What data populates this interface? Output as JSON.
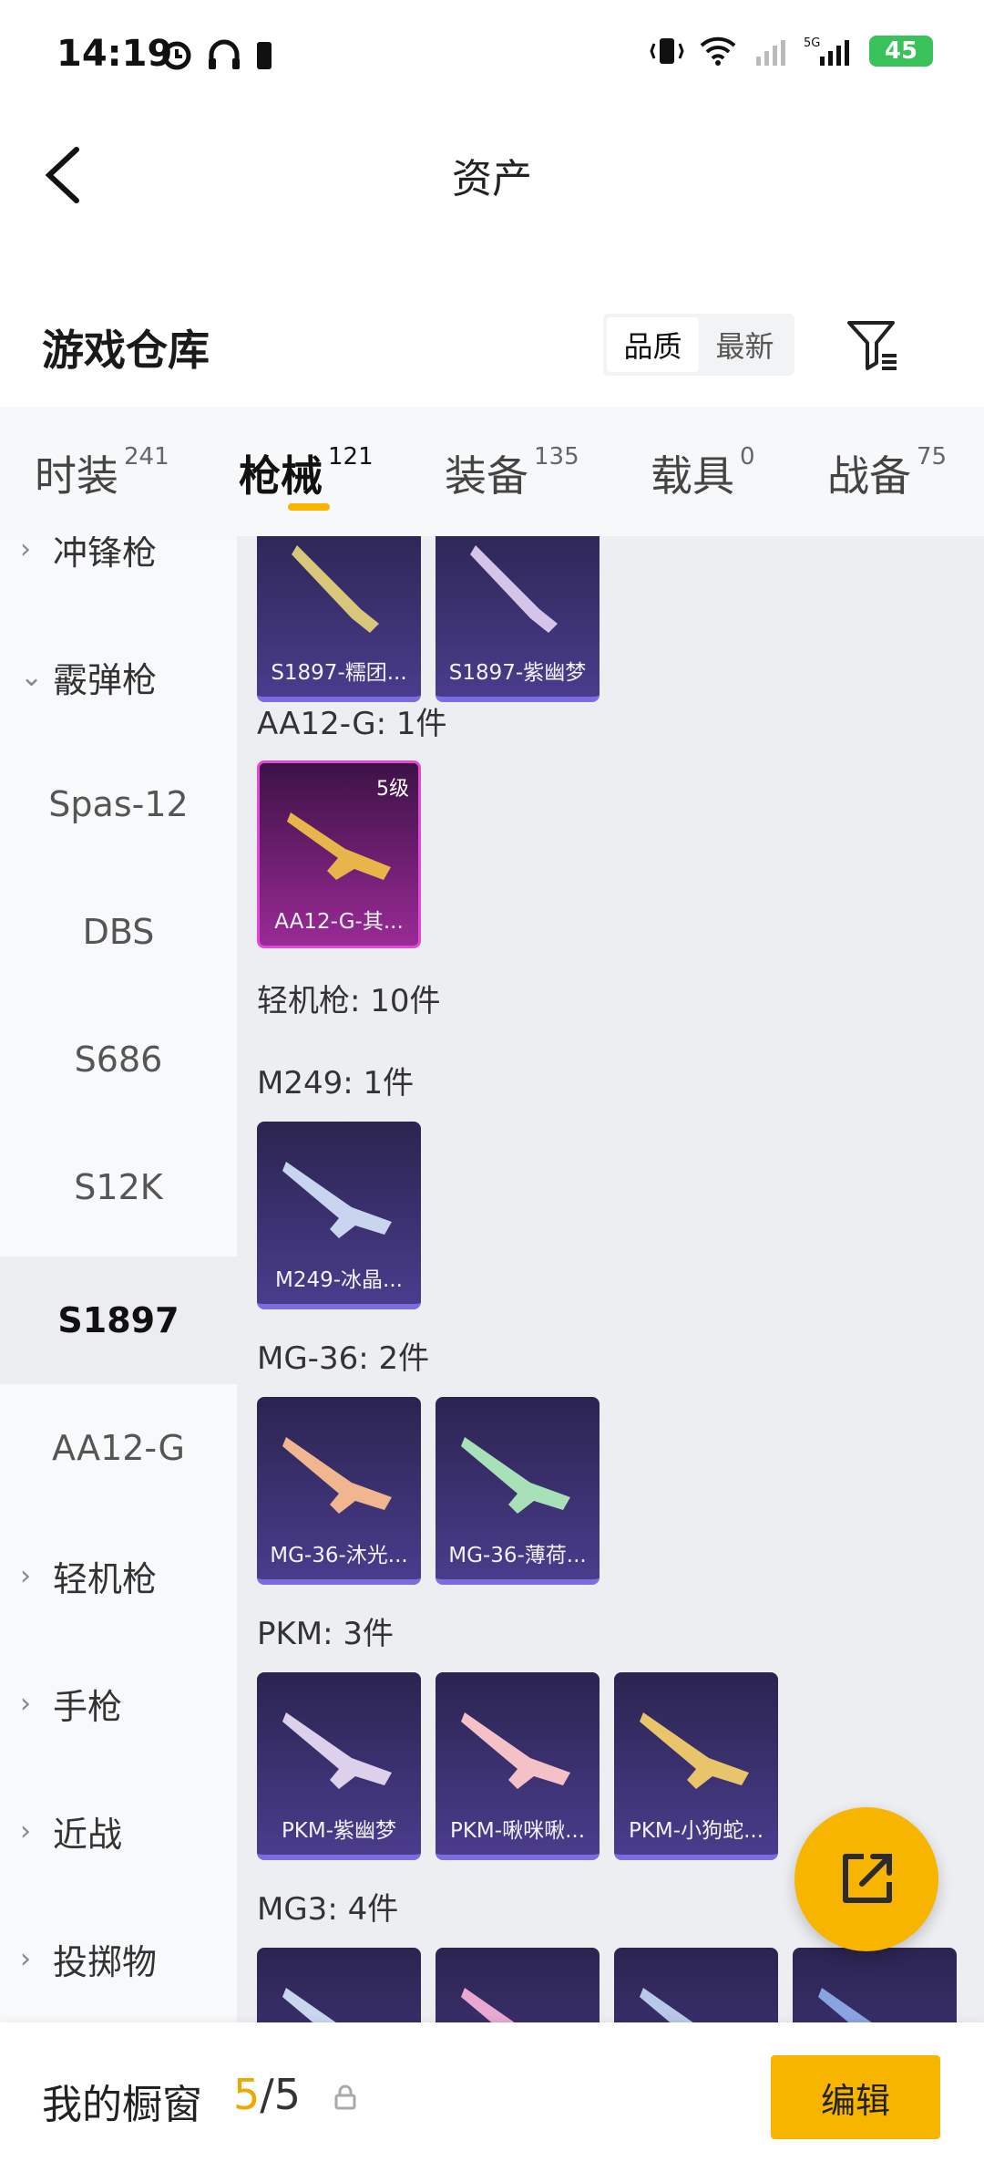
{
  "status_bar": {
    "time": "14:19",
    "battery": "45",
    "network": "5G"
  },
  "header": {
    "title": "资产"
  },
  "warehouse": {
    "title": "游戏仓库",
    "sort": {
      "quality": "品质",
      "newest": "最新",
      "active": "quality"
    }
  },
  "tabs": [
    {
      "label": "时装",
      "count": "241"
    },
    {
      "label": "枪械",
      "count": "121",
      "active": true
    },
    {
      "label": "装备",
      "count": "135"
    },
    {
      "label": "载具",
      "count": "0"
    },
    {
      "label": "战备",
      "count": "75"
    }
  ],
  "sidebar": [
    {
      "label": "冲锋枪",
      "type": "category",
      "chevron": "right"
    },
    {
      "label": "霰弹枪",
      "type": "category",
      "chevron": "down"
    },
    {
      "label": "Spas-12",
      "type": "sub"
    },
    {
      "label": "DBS",
      "type": "sub"
    },
    {
      "label": "S686",
      "type": "sub"
    },
    {
      "label": "S12K",
      "type": "sub"
    },
    {
      "label": "S1897",
      "type": "sub",
      "selected": true
    },
    {
      "label": "AA12-G",
      "type": "sub"
    },
    {
      "label": "轻机枪",
      "type": "category",
      "chevron": "right"
    },
    {
      "label": "手枪",
      "type": "category",
      "chevron": "right"
    },
    {
      "label": "近战",
      "type": "category",
      "chevron": "right"
    },
    {
      "label": "投掷物",
      "type": "category",
      "chevron": "right"
    }
  ],
  "content": {
    "top_cards": [
      {
        "name": "S1897-糯团..."
      },
      {
        "name": "S1897-紫幽梦"
      }
    ],
    "aa12_label": "AA12-G: 1件",
    "aa12_cards": [
      {
        "name": "AA12-G-其...",
        "level": "5级"
      }
    ],
    "lmg_label": "轻机枪: 10件",
    "m249_label": "M249: 1件",
    "m249_cards": [
      {
        "name": "M249-冰晶..."
      }
    ],
    "mg36_label": "MG-36: 2件",
    "mg36_cards": [
      {
        "name": "MG-36-沐光..."
      },
      {
        "name": "MG-36-薄荷..."
      }
    ],
    "pkm_label": "PKM: 3件",
    "pkm_cards": [
      {
        "name": "PKM-紫幽梦"
      },
      {
        "name": "PKM-啾咪啾..."
      },
      {
        "name": "PKM-小狗蛇..."
      }
    ],
    "mg3_label": "MG3: 4件"
  },
  "bottom": {
    "title": "我的橱窗",
    "current": "5",
    "total": "/5",
    "edit": "编辑"
  },
  "colors": {
    "accent": "#f7b500",
    "card_purple": "#4a3c8c",
    "card_pink": "#9a2a96"
  }
}
